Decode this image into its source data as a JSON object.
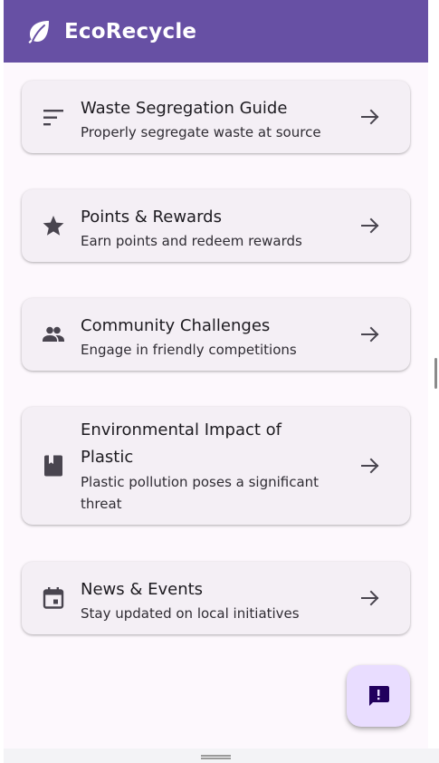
{
  "app": {
    "title": "EcoRecycle",
    "brand_color": "#6750a4",
    "logo_icon": "leaf-icon"
  },
  "cards": [
    {
      "icon": "sort-lines-icon",
      "title": "Waste Segregation Guide",
      "subtitle": "Properly segregate waste at source",
      "trailing_icon": "arrow-forward-icon"
    },
    {
      "icon": "star-icon",
      "title": "Points & Rewards",
      "subtitle": "Earn points and redeem rewards",
      "trailing_icon": "arrow-forward-icon"
    },
    {
      "icon": "people-icon",
      "title": "Community Challenges",
      "subtitle": "Engage in friendly competitions",
      "trailing_icon": "arrow-forward-icon"
    },
    {
      "icon": "book-icon",
      "title_line1": "Environmental Impact of",
      "title_line2": "Plastic",
      "subtitle_line1": "Plastic pollution poses a significant",
      "subtitle_line2": "threat",
      "trailing_icon": "arrow-forward-icon"
    },
    {
      "icon": "calendar-icon",
      "title": "News & Events",
      "subtitle": "Stay updated on local initiatives",
      "trailing_icon": "arrow-forward-icon"
    }
  ],
  "fab": {
    "icon": "feedback-icon",
    "color": "#e9ddff"
  }
}
